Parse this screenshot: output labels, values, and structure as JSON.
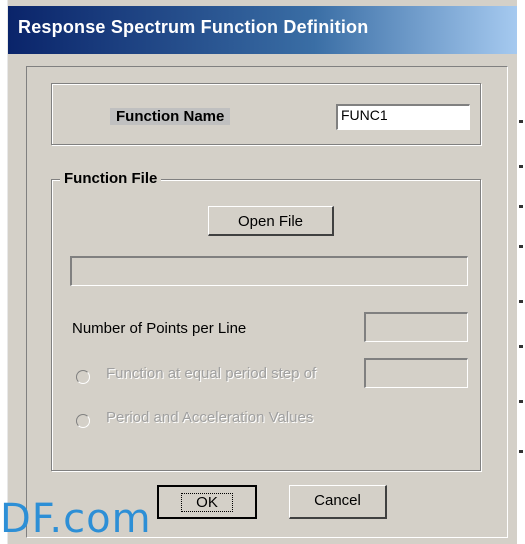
{
  "window": {
    "title": "Response Spectrum Function Definition"
  },
  "function_name": {
    "label": "Function Name",
    "value": "FUNC1"
  },
  "function_file": {
    "caption": "Function File",
    "open_button": "Open File",
    "file_path_value": "",
    "points_per_line_label": "Number of Points per Line",
    "points_per_line_value": "",
    "radio_equal_period_label": "Function at equal period step of",
    "equal_period_value": "",
    "radio_period_accel_label": "Period and Acceleration Values"
  },
  "buttons": {
    "ok": "OK",
    "cancel": "Cancel"
  },
  "watermark": {
    "text": "DF.com"
  }
}
